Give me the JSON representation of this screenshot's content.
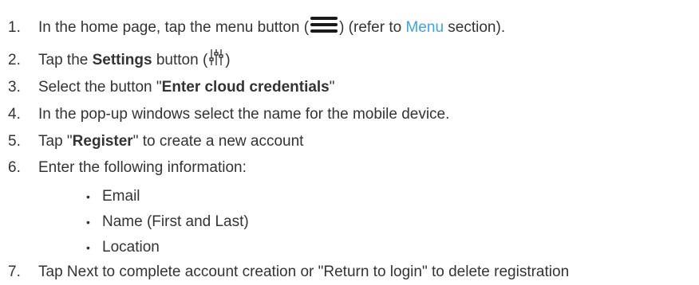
{
  "steps": [
    {
      "num": "1.",
      "pre": "In the home page, tap the menu button (",
      "icon": "menu-icon",
      "mid": ") (refer to ",
      "link": "Menu",
      "post": " section)."
    },
    {
      "num": "2.",
      "pre": "Tap the ",
      "bold": "Settings",
      "mid": " button (",
      "icon": "settings-sliders-icon",
      "post": ")"
    },
    {
      "num": "3.",
      "pre": "Select the button \"",
      "bold": "Enter cloud credentials",
      "post": "\""
    },
    {
      "num": "4.",
      "text": "In the pop-up windows select the name for the mobile device."
    },
    {
      "num": "5.",
      "pre": "Tap \"",
      "bold": "Register",
      "post": "\" to create a new account"
    },
    {
      "num": "6.",
      "text": "Enter the following information:"
    },
    {
      "num": "7.",
      "text": "Tap Next to complete account creation or \"Return to login\" to delete registration"
    }
  ],
  "bullets": [
    "Email",
    "Name (First and Last)",
    "Location"
  ],
  "bullet_glyph": "•",
  "colors": {
    "text": "#333333",
    "link": "#3aa6e8",
    "icon": "#1a1a1a"
  }
}
